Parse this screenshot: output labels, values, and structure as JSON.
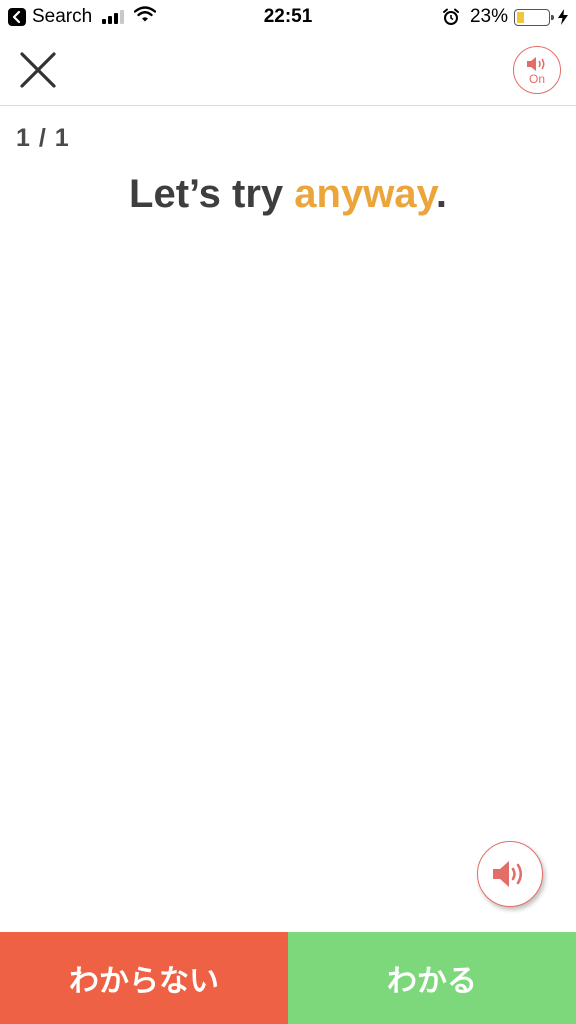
{
  "status_bar": {
    "back_label": "Search",
    "time": "22:51",
    "battery_percent": "23%",
    "battery_level": 0.23
  },
  "header": {
    "close_icon": "close-x-icon",
    "sound_toggle_label": "On"
  },
  "card": {
    "counter": "1 / 1",
    "sentence_prefix": "Let’s try ",
    "sentence_highlight": "anyway",
    "sentence_suffix": "."
  },
  "buttons": {
    "unknown_label": "わからない",
    "known_label": "わかる"
  },
  "colors": {
    "accent_red": "#e36e67",
    "highlight": "#eba53a",
    "unknown_bg": "#ee6144",
    "known_bg": "#7cd87b"
  }
}
